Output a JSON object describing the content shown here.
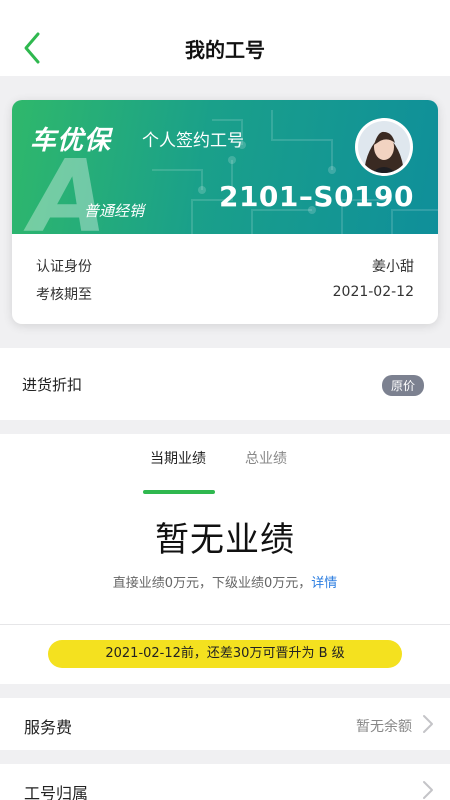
{
  "nav": {
    "title": "我的工号"
  },
  "card": {
    "brand": "车优保",
    "subtitle": "个人签约工号",
    "level_letter": "A",
    "level_label": "普通经销",
    "job_number": "2101–S0190",
    "identity_label": "认证身份",
    "identity_value": "姜小甜",
    "assess_label": "考核期至",
    "assess_value": "2021-02-12"
  },
  "discount": {
    "label": "进货折扣",
    "badge": "原价"
  },
  "performance": {
    "tabs": [
      {
        "label": "当期业绩",
        "active": true
      },
      {
        "label": "总业绩",
        "active": false
      }
    ],
    "empty_text": "暂无业绩",
    "detail_text": "直接业绩0万元，下级业绩0万元，",
    "detail_link": "详情",
    "promo_text": "2021-02-12前，还差30万可晋升为 B 级"
  },
  "service": {
    "label": "服务费",
    "value": "暂无余额"
  },
  "belong": {
    "label": "工号归属"
  },
  "colors": {
    "accent": "#2fb84f",
    "card_from": "#2fb86b",
    "card_to": "#0f8f9a",
    "promo": "#f4e11f",
    "link": "#2b7de0"
  }
}
